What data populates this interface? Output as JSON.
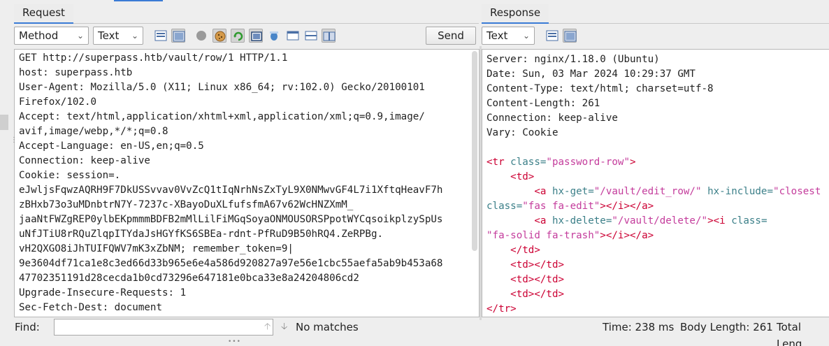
{
  "request": {
    "tab_label": "Request",
    "method_select": "Method",
    "format_select": "Text",
    "send_label": "Send",
    "lines": [
      "GET http://superpass.htb/vault/row/1 HTTP/1.1",
      "host: superpass.htb",
      "User-Agent: Mozilla/5.0 (X11; Linux x86_64; rv:102.0) Gecko/20100101",
      "Firefox/102.0",
      "Accept: text/html,application/xhtml+xml,application/xml;q=0.9,image/",
      "avif,image/webp,*/*;q=0.8",
      "Accept-Language: en-US,en;q=0.5",
      "Connection: keep-alive",
      "Cookie: session=.",
      "eJwljsFqwzAQRH9F7DkUSSvvav0VvZcQ1tIqNrhNsZxTyL9X0NMwvGF4L7i1XftqHeavF7h",
      "zBHxb73o3uMDnbtrN7Y-7237c-XBayoDuXLfufsfmA67v62WcHNZXmM_",
      "jaaNtFWZgREP0ylbEKpmmmBDFB2mMlLilFiMGqSoyaONMOUSORSPpotWYCqsoikplzySpUs",
      "uNfJTiU8rRQuZlqpITYdaJsHGYfKS6SBEa-rdnt-PfRuD9B50hRQ4.ZeRPBg.",
      "vH2QXGO8iJhTUIFQWV7mK3xZbNM; remember_token=9|",
      "9e3604df71ca1e8c3ed66d33b965e6e4a586d920827a97e56e1cbc55aefa5ab9b453a68",
      "47702351191d28cecda1b0cd73296e647181e0bca33e8a24204806cd2",
      "Upgrade-Insecure-Requests: 1",
      "Sec-Fetch-Dest: document"
    ]
  },
  "response": {
    "tab_label": "Response",
    "format_select": "Text",
    "header_lines": [
      "Server: nginx/1.18.0 (Ubuntu)",
      "Date: Sun, 03 Mar 2024 10:29:37 GMT",
      "Content-Type: text/html; charset=utf-8",
      "Content-Length: 261",
      "Connection: keep-alive",
      "Vary: Cookie"
    ],
    "body_lines": [
      [
        [
          "t-tag",
          "<tr "
        ],
        [
          "t-attr",
          "class="
        ],
        [
          "t-val",
          "\"password-row\""
        ],
        [
          "t-tag",
          ">"
        ]
      ],
      [
        [
          "t-txt",
          "    "
        ],
        [
          "t-tag",
          "<td>"
        ]
      ],
      [
        [
          "t-txt",
          "        "
        ],
        [
          "t-tag",
          "<a "
        ],
        [
          "t-attr",
          "hx-get="
        ],
        [
          "t-val",
          "\"/vault/edit_row/\""
        ],
        [
          "t-txt",
          " "
        ],
        [
          "t-attr",
          "hx-include="
        ],
        [
          "t-val",
          "\"closest"
        ]
      ],
      [
        [
          "t-attr",
          "class="
        ],
        [
          "t-val",
          "\"fas fa-edit\""
        ],
        [
          "t-tag",
          "></i></a>"
        ]
      ],
      [
        [
          "t-txt",
          "        "
        ],
        [
          "t-tag",
          "<a "
        ],
        [
          "t-attr",
          "hx-delete="
        ],
        [
          "t-val",
          "\"/vault/delete/\""
        ],
        [
          "t-tag",
          "><i "
        ],
        [
          "t-attr",
          "class="
        ]
      ],
      [
        [
          "t-val",
          "\"fa-solid fa-trash\""
        ],
        [
          "t-tag",
          "></i></a>"
        ]
      ],
      [
        [
          "t-txt",
          "    "
        ],
        [
          "t-tag",
          "</td>"
        ]
      ],
      [
        [
          "t-txt",
          "    "
        ],
        [
          "t-tag",
          "<td></td>"
        ]
      ],
      [
        [
          "t-txt",
          "    "
        ],
        [
          "t-tag",
          "<td></td>"
        ]
      ],
      [
        [
          "t-txt",
          "    "
        ],
        [
          "t-tag",
          "<td></td>"
        ]
      ],
      [
        [
          "t-tag",
          "</tr>"
        ]
      ]
    ]
  },
  "find": {
    "label": "Find:",
    "value": "",
    "no_matches": "No matches"
  },
  "status": {
    "time": "Time: 238 ms",
    "body_length": "Body Length: 261",
    "total_length": "Total Leng"
  }
}
